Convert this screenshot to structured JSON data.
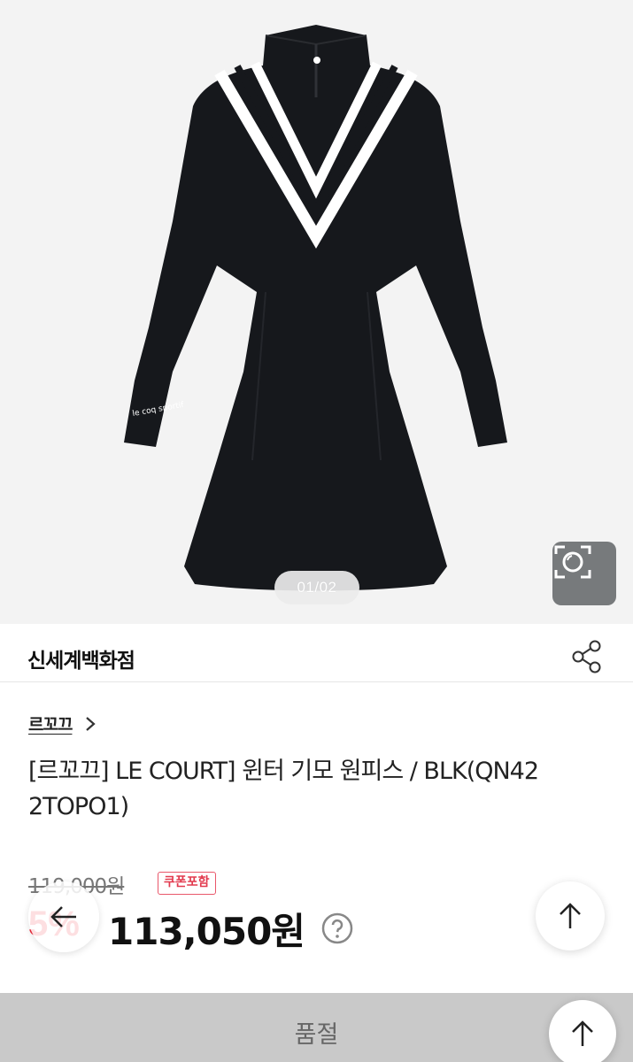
{
  "gallery": {
    "counter": "01/02",
    "sleeve_logo_text": "le coq sportif"
  },
  "store": {
    "name": "신세계백화점"
  },
  "product": {
    "brand": "르꼬끄",
    "title": "[르꼬끄] LE COURT] 윈터 기모 원피스 / BLK(QN42 2TOPO1)",
    "original_price": "119,000원",
    "coupon_badge": "쿠폰포함",
    "discount": "5%",
    "sale_price": "113,050원"
  },
  "bottom": {
    "soldout_label": "품절"
  },
  "icons": {
    "camera": "camera-search-icon",
    "share": "share-icon",
    "chevron": "chevron-right-icon",
    "help": "question-circle-icon",
    "back": "arrow-left-icon",
    "scroll_top": "arrow-up-icon"
  },
  "colors": {
    "discount": "#ee2a3a",
    "coupon_badge": "#e23a4e",
    "soldout_bar": "#c9c9c9",
    "dress": "#16181c"
  }
}
